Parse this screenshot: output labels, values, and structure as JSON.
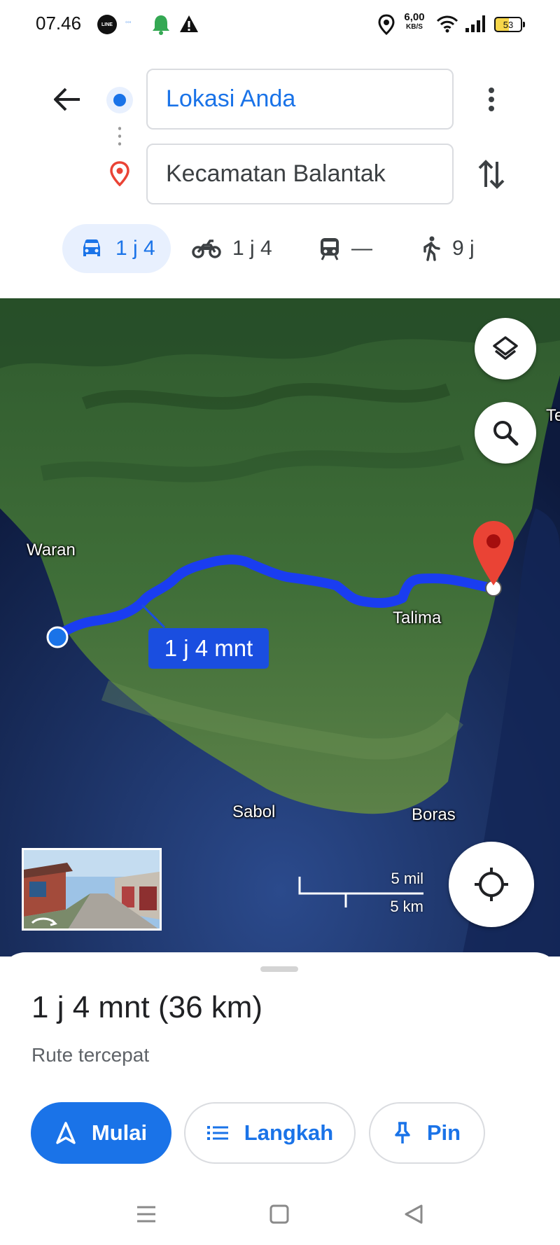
{
  "status_bar": {
    "time": "07.46",
    "line_label": "LINE",
    "speed_value": "6,00",
    "speed_unit": "KB/S",
    "battery": "53"
  },
  "route": {
    "origin": "Lokasi Anda",
    "destination": "Kecamatan Balantak"
  },
  "modes": [
    {
      "icon": "car-icon",
      "label": "1 j 4",
      "selected": true
    },
    {
      "icon": "motorcycle-icon",
      "label": "1 j 4"
    },
    {
      "icon": "transit-icon",
      "label": "—"
    },
    {
      "icon": "walk-icon",
      "label": "9 j"
    }
  ],
  "map": {
    "places": [
      "Waran",
      "Talima",
      "Sabol",
      "Boras",
      "Te"
    ],
    "route_duration": "1 j 4 mnt",
    "scale": {
      "imperial": "5 mil",
      "metric": "5 km"
    },
    "colors": {
      "route": "#1a3df0",
      "pin": "#ea4335",
      "sea": "#1b2c5e",
      "land": "#3e6a36"
    }
  },
  "sheet": {
    "summary": "1 j 4 mnt (36 km)",
    "subtitle": "Rute tercepat",
    "buttons": {
      "start": "Mulai",
      "steps": "Langkah",
      "pin": "Pin"
    }
  },
  "accent_color": "#1a73e8"
}
